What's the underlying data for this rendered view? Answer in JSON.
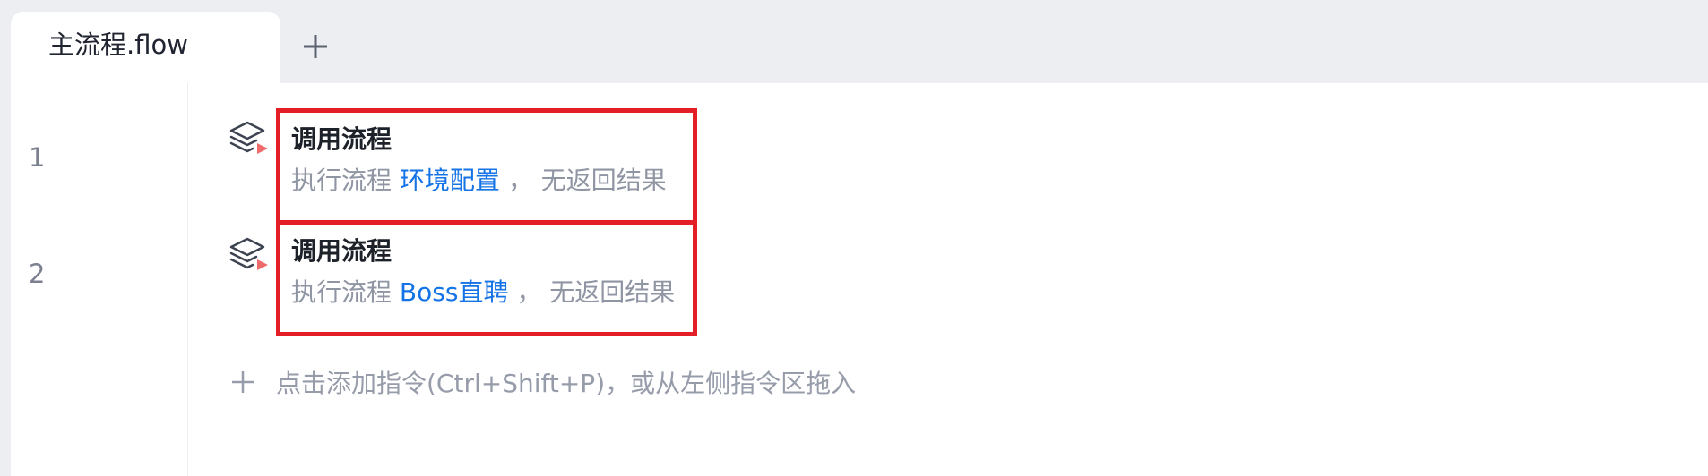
{
  "tabs": [
    {
      "label": "主流程.flow",
      "active": true
    }
  ],
  "tab_add_icon": "plus-icon",
  "steps": [
    {
      "line": "1",
      "icon": "subflow-layers-icon",
      "title": "调用流程",
      "desc_prefix": "执行流程",
      "flow_name": "环境配置",
      "desc_suffix": "， 无返回结果"
    },
    {
      "line": "2",
      "icon": "subflow-layers-icon",
      "title": "调用流程",
      "desc_prefix": "执行流程",
      "flow_name": "Boss直聘",
      "desc_suffix": "， 无返回结果"
    }
  ],
  "add_command": {
    "icon": "plus-icon",
    "label": "点击添加指令(Ctrl+Shift+P)，或从左侧指令区拖入"
  },
  "colors": {
    "highlight_border": "#e21f26",
    "link": "#1473e6",
    "icon_accent": "#ef6b6b"
  }
}
